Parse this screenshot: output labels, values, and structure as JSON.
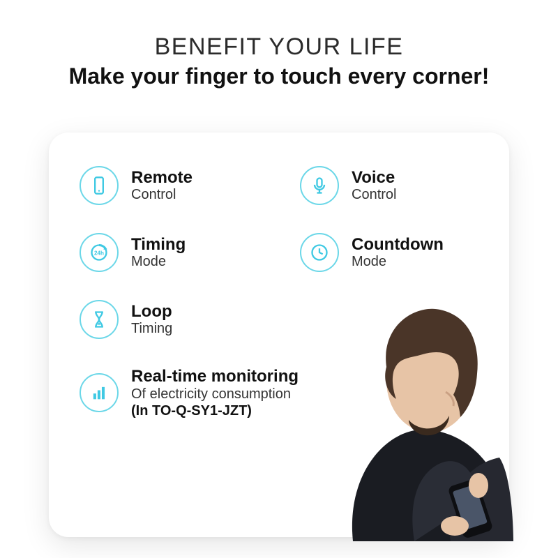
{
  "header": {
    "title": "BENEFIT YOUR LIFE",
    "subtitle": "Make your finger to touch every corner!"
  },
  "features": [
    {
      "icon": "phone-icon",
      "title": "Remote",
      "subtitle": "Control"
    },
    {
      "icon": "microphone-icon",
      "title": "Voice",
      "subtitle": "Control"
    },
    {
      "icon": "timer-24h-icon",
      "title": "Timing",
      "subtitle": "Mode"
    },
    {
      "icon": "clock-icon",
      "title": "Countdown",
      "subtitle": "Mode"
    },
    {
      "icon": "hourglass-icon",
      "title": "Loop",
      "subtitle": "Timing"
    }
  ],
  "monitoring": {
    "icon": "bar-chart-icon",
    "title": "Real-time monitoring",
    "subtitle": "Of electricity consumption",
    "note": "(In TO-Q-SY1-JZT)"
  },
  "colors": {
    "accent": "#3fc9e3",
    "ring": "#6bd7e8"
  }
}
